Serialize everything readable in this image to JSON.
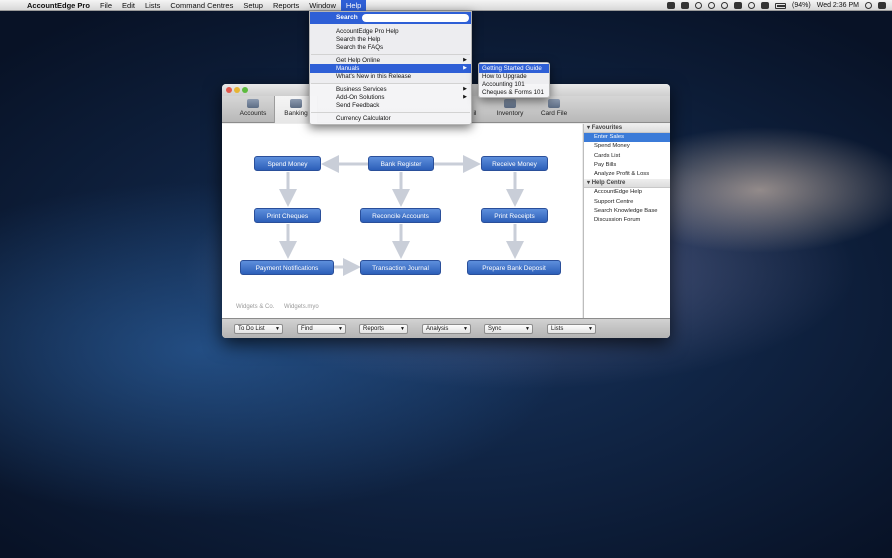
{
  "menubar": {
    "app_name": "AccountEdge Pro",
    "items": [
      "File",
      "Edit",
      "Lists",
      "Command Centres",
      "Setup",
      "Reports",
      "Window",
      "Help"
    ],
    "battery": "(94%)",
    "clock": "Wed 2:36 PM"
  },
  "help_menu": {
    "search_label": "Search",
    "items": [
      "AccountEdge Pro Help",
      "Search the Help",
      "Search the FAQs",
      "Get Help Online",
      "Manuals",
      "What's New in this Release",
      "Business Services",
      "Add-On Solutions",
      "Send Feedback",
      "Currency Calculator"
    ]
  },
  "manuals_submenu": {
    "items": [
      "Getting Started Guide",
      "How to Upgrade",
      "Accounting 101",
      "Cheques & Forms 101"
    ]
  },
  "toolbar": {
    "tabs": [
      "Accounts",
      "Banking",
      "il",
      "Inventory",
      "Card File"
    ]
  },
  "flowchart": {
    "spend_money": "Spend Money",
    "bank_register": "Bank Register",
    "receive_money": "Receive Money",
    "print_cheques": "Print Cheques",
    "reconcile_accounts": "Reconcile Accounts",
    "print_receipts": "Print Receipts",
    "payment_notifications": "Payment Notifications",
    "transaction_journal": "Transaction Journal",
    "prepare_bank_deposit": "Prepare Bank Deposit"
  },
  "watermark": {
    "company": "Widgets & Co.",
    "file": "Widgets.myo"
  },
  "sidebar": {
    "favourites_header": "Favourites",
    "favourites": [
      "Enter Sales",
      "Spend Money",
      "Cards List",
      "Pay Bills",
      "Analyze Profit & Loss"
    ],
    "help_header": "Help Centre",
    "help": [
      "AccountEdge Help",
      "Support Centre",
      "Search Knowledge Base",
      "Discussion Forum"
    ]
  },
  "bottombar": {
    "popups": [
      "To Do List",
      "Find",
      "Reports",
      "Analysis",
      "Sync",
      "Lists"
    ]
  }
}
